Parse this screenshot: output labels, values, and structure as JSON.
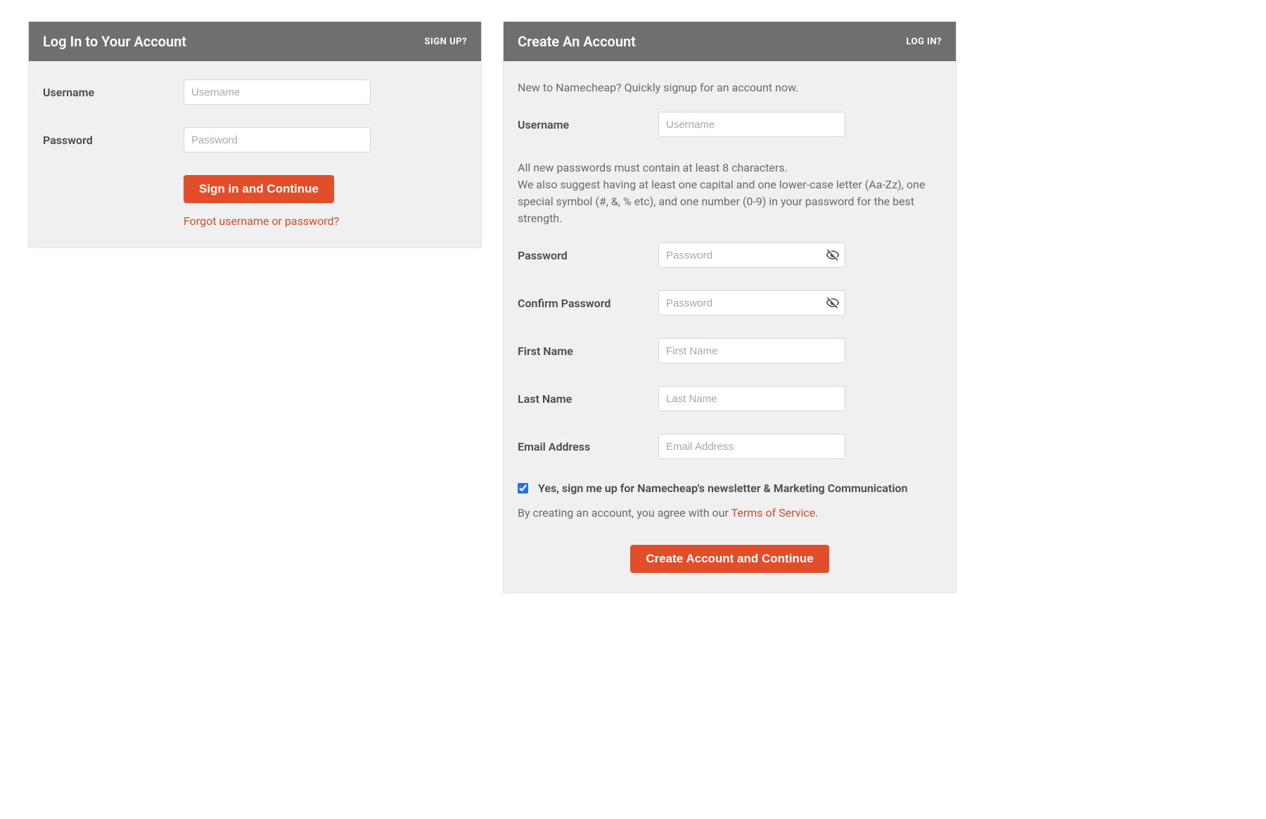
{
  "login": {
    "title": "Log In to Your Account",
    "alt_link": "SIGN UP?",
    "username_label": "Username",
    "username_placeholder": "Username",
    "password_label": "Password",
    "password_placeholder": "Password",
    "submit_label": "Sign in and Continue",
    "forgot_label": "Forgot username or password?"
  },
  "signup": {
    "title": "Create An Account",
    "alt_link": "LOG IN?",
    "intro": "New to Namecheap? Quickly signup for an account now.",
    "username_label": "Username",
    "username_placeholder": "Username",
    "password_hint": "All new passwords must contain at least 8 characters.\nWe also suggest having at least one capital and one lower-case letter (Aa-Zz), one special symbol (#, &, % etc), and one number (0-9) in your password for the best strength.",
    "password_label": "Password",
    "password_placeholder": "Password",
    "confirm_label": "Confirm Password",
    "confirm_placeholder": "Password",
    "firstname_label": "First Name",
    "firstname_placeholder": "First Name",
    "lastname_label": "Last Name",
    "lastname_placeholder": "Last Name",
    "email_label": "Email Address",
    "email_placeholder": "Email Address",
    "newsletter_label": "Yes, sign me up for Namecheap's newsletter & Marketing Communication",
    "newsletter_checked": true,
    "tos_prefix": "By creating an account, you agree with our ",
    "tos_link": "Terms of Service",
    "tos_suffix": ".",
    "submit_label": "Create Account and Continue"
  }
}
